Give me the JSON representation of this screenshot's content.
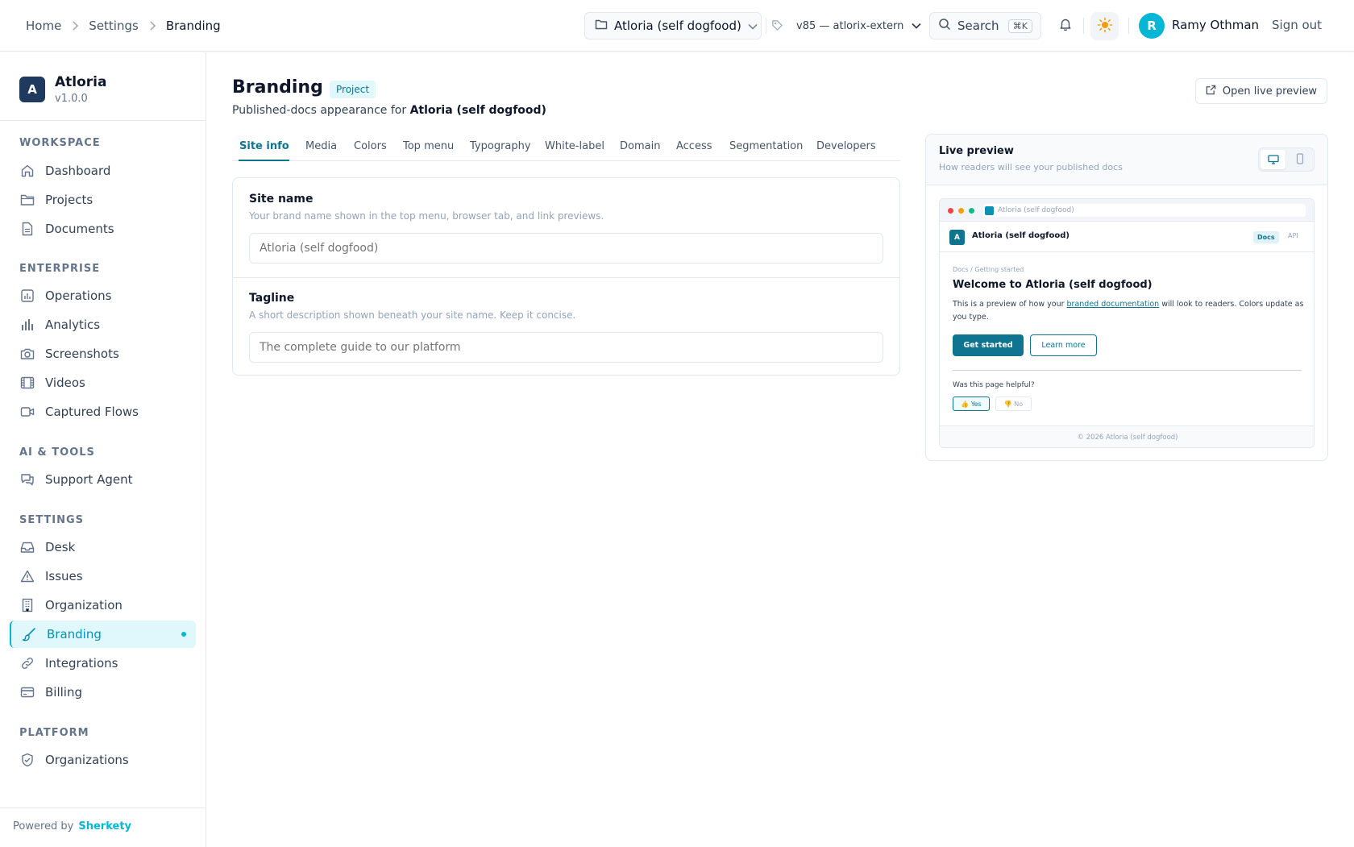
{
  "header": {
    "breadcrumb": [
      "Home",
      "Settings",
      "Branding"
    ],
    "project_select": "Atloria (self dogfood)",
    "version_select": "v85 — atlorix-extern",
    "search_label": "Search",
    "search_shortcut": "⌘K",
    "user_initial": "R",
    "user_name": "Ramy Othman",
    "sign_out": "Sign out"
  },
  "sidebar": {
    "brand_initial": "A",
    "brand_name": "Atloria",
    "brand_version": "v1.0.0",
    "sections": {
      "workspace": "WORKSPACE",
      "enterprise": "ENTERPRISE",
      "ai_tools": "AI & TOOLS",
      "settings": "SETTINGS",
      "platform": "PLATFORM"
    },
    "items": {
      "dashboard": "Dashboard",
      "projects": "Projects",
      "documents": "Documents",
      "operations": "Operations",
      "analytics": "Analytics",
      "screenshots": "Screenshots",
      "videos": "Videos",
      "captured_flows": "Captured Flows",
      "support_agent": "Support Agent",
      "desk": "Desk",
      "issues": "Issues",
      "organization": "Organization",
      "branding": "Branding",
      "integrations": "Integrations",
      "billing": "Billing",
      "organizations": "Organizations"
    },
    "powered_by": "Powered by",
    "powered_brand": "Sherkety"
  },
  "main": {
    "title": "Branding",
    "badge": "Project",
    "subtitle_prefix": "Published-docs appearance for",
    "subtitle_project": "Atloria (self dogfood)",
    "open_live_preview": "Open live preview",
    "tabs": [
      "Site info",
      "Media",
      "Colors",
      "Top menu",
      "Typography",
      "White-label",
      "Domain",
      "Access",
      "Segmentation",
      "Developers"
    ],
    "site_name": {
      "label": "Site name",
      "help": "Your brand name shown in the top menu, browser tab, and link previews.",
      "placeholder": "Atloria (self dogfood)"
    },
    "tagline": {
      "label": "Tagline",
      "help": "A short description shown beneath your site name. Keep it concise.",
      "placeholder": "The complete guide to our platform"
    }
  },
  "preview": {
    "title": "Live preview",
    "subtitle": "How readers will see your published docs",
    "url_text": "Atloria (self dogfood)",
    "logo_initial": "A",
    "site_name": "Atloria (self dogfood)",
    "nav_docs": "Docs",
    "nav_api": "API",
    "crumb": "Docs / Getting started",
    "heading": "Welcome to Atloria (self dogfood)",
    "para_before": "This is a preview of how your ",
    "para_link": "branded documentation",
    "para_after": " will look to readers. Colors update as you type.",
    "primary_button": "Get started",
    "secondary_button": "Learn more",
    "helpful_question": "Was this page helpful?",
    "yes": "👍 Yes",
    "no": "👎 No",
    "footer": "© 2026 Atloria (self dogfood)"
  },
  "colors": {
    "accent": "#06b6d4",
    "primary": "#0e7490",
    "brand_logo": "#1e3a5f"
  }
}
